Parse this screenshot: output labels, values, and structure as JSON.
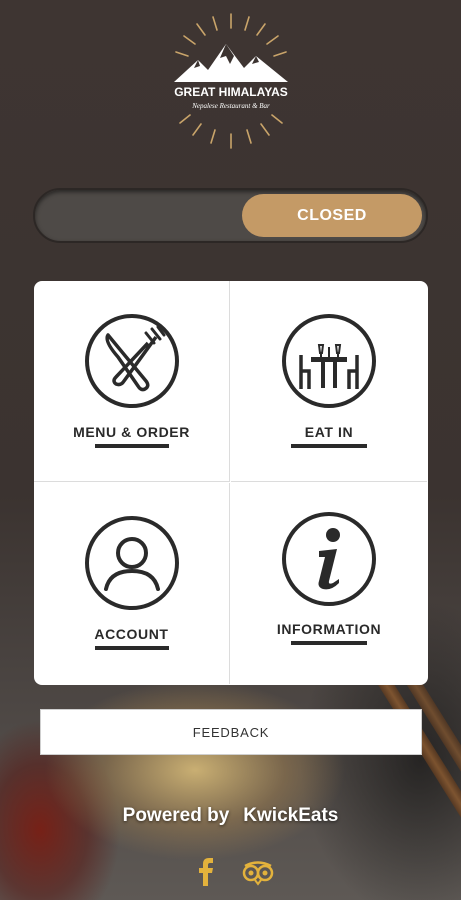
{
  "brand": {
    "name": "GREAT HIMALAYAS",
    "tagline": "Nepalese Restaurant & Bar",
    "color": "#c9a46a"
  },
  "status_toggle": {
    "label": "CLOSED",
    "accent_color": "#c49a66"
  },
  "tiles": [
    {
      "label": "MENU & ORDER",
      "icon": "fork-knife-icon"
    },
    {
      "label": "EAT IN",
      "icon": "dining-table-icon"
    },
    {
      "label": "ACCOUNT",
      "icon": "person-icon"
    },
    {
      "label": "INFORMATION",
      "icon": "info-icon"
    }
  ],
  "feedback": {
    "label": "FEEDBACK"
  },
  "footer": {
    "powered_by": "Powered by",
    "provider": "KwickEats",
    "social": [
      {
        "icon": "facebook-icon",
        "color": "#e3b23c"
      },
      {
        "icon": "tripadvisor-icon",
        "color": "#e3b23c"
      }
    ]
  }
}
